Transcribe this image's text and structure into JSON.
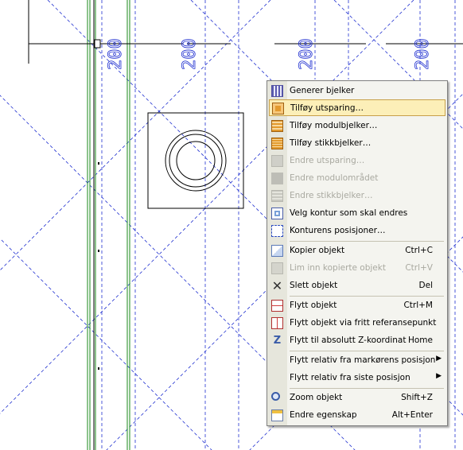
{
  "canvas": {
    "dimension_label": "200"
  },
  "context_menu": {
    "items": [
      {
        "label": "Generer bjelker",
        "shortcut": "",
        "icon": "generate-beams-icon",
        "enabled": true
      },
      {
        "label": "Tilføy utsparing…",
        "shortcut": "",
        "icon": "add-opening-icon",
        "enabled": true,
        "highlighted": true
      },
      {
        "label": "Tilføy modulbjelker…",
        "shortcut": "",
        "icon": "add-module-beams-icon",
        "enabled": true
      },
      {
        "label": "Tilføy stikkbjelker…",
        "shortcut": "",
        "icon": "add-stub-beams-icon",
        "enabled": true
      },
      {
        "label": "Endre utsparing…",
        "shortcut": "",
        "icon": "edit-opening-icon",
        "enabled": false
      },
      {
        "label": "Endre modulområdet",
        "shortcut": "",
        "icon": "edit-module-area-icon",
        "enabled": false
      },
      {
        "label": "Endre stikkbjelker…",
        "shortcut": "",
        "icon": "edit-stub-beams-icon",
        "enabled": false
      },
      {
        "label": "Velg kontur som skal endres",
        "shortcut": "",
        "icon": "select-contour-icon",
        "enabled": true
      },
      {
        "label": "Konturens posisjoner…",
        "shortcut": "",
        "icon": "contour-positions-icon",
        "enabled": true
      },
      {
        "label": "Kopier objekt",
        "shortcut": "Ctrl+C",
        "icon": "copy-icon",
        "enabled": true
      },
      {
        "label": "Lim inn kopierte objekt",
        "shortcut": "Ctrl+V",
        "icon": "paste-icon",
        "enabled": false
      },
      {
        "label": "Slett objekt",
        "shortcut": "Del",
        "icon": "delete-icon",
        "enabled": true
      },
      {
        "label": "Flytt objekt",
        "shortcut": "Ctrl+M",
        "icon": "move-icon",
        "enabled": true
      },
      {
        "label": "Flytt objekt via fritt referansepunkt",
        "shortcut": "",
        "icon": "move-reference-icon",
        "enabled": true
      },
      {
        "label": "Flytt til absolutt Z-koordinat",
        "shortcut": "Home",
        "icon": "z-coordinate-icon",
        "enabled": true
      },
      {
        "label": "Flytt relativ fra markørens posisjon",
        "shortcut": "",
        "icon": "",
        "enabled": true,
        "submenu": true
      },
      {
        "label": "Flytt relativ fra siste posisjon",
        "shortcut": "",
        "icon": "",
        "enabled": true,
        "submenu": true
      },
      {
        "label": "Zoom objekt",
        "shortcut": "Shift+Z",
        "icon": "zoom-icon",
        "enabled": true
      },
      {
        "label": "Endre egenskap",
        "shortcut": "Alt+Enter",
        "icon": "properties-icon",
        "enabled": true
      }
    ]
  },
  "colors": {
    "grid_line": "#2030d0",
    "green_line": "#1a8a1a",
    "highlight": "#fcefb8",
    "highlight_border": "#c7a04a"
  }
}
